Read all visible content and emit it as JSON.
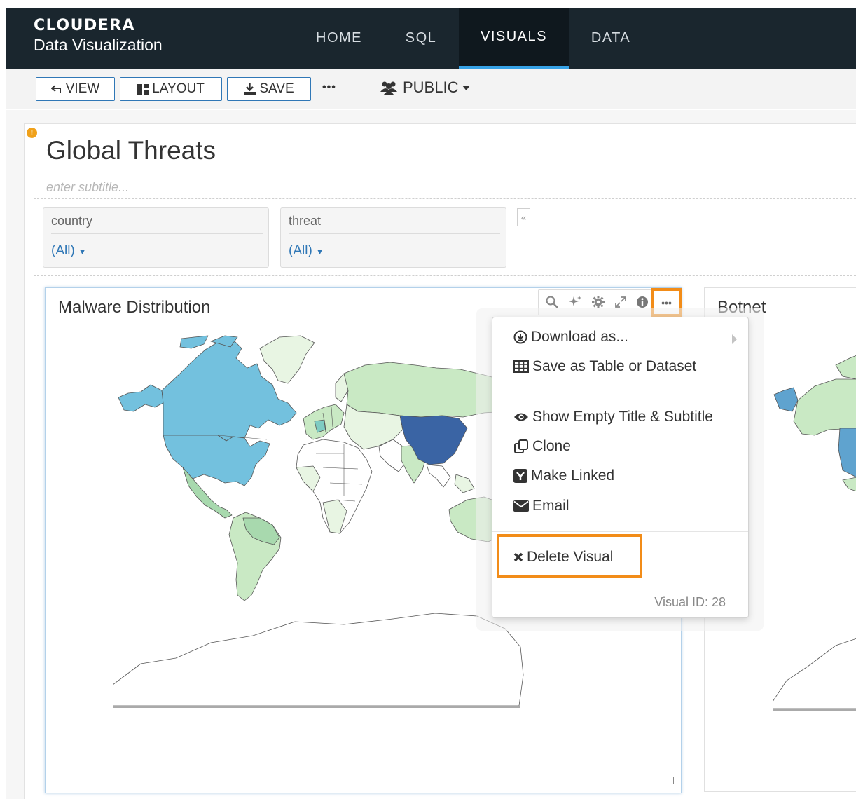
{
  "brand": {
    "name": "CLOUDERA",
    "product": "Data Visualization"
  },
  "nav": {
    "tabs": [
      {
        "label": "HOME"
      },
      {
        "label": "SQL"
      },
      {
        "label": "VISUALS"
      },
      {
        "label": "DATA"
      }
    ],
    "active": "VISUALS"
  },
  "toolbar": {
    "view_label": "VIEW",
    "layout_label": "LAYOUT",
    "save_label": "SAVE",
    "more_label": "•••",
    "visibility_label": "PUBLIC"
  },
  "dashboard": {
    "title": "Global Threats",
    "subtitle_placeholder": "enter subtitle..."
  },
  "filters": [
    {
      "label": "country",
      "value": "(All)"
    },
    {
      "label": "threat",
      "value": "(All)"
    }
  ],
  "filters_collapse_label": "«",
  "visuals": [
    {
      "title": "Malware Distribution"
    },
    {
      "title": "Botnet"
    }
  ],
  "menu": {
    "download": "Download as...",
    "save_table": "Save as Table or Dataset",
    "show_empty": "Show Empty Title & Subtitle",
    "clone": "Clone",
    "make_linked": "Make Linked",
    "email": "Email",
    "delete": "Delete Visual",
    "visual_id": "Visual ID: 28"
  },
  "map": {
    "colors": {
      "darkest": "#3a64a4",
      "dark": "#5fa3cf",
      "medium": "#73c1de",
      "teal": "#7ecbc2",
      "light": "#a8d9ae",
      "lighter": "#c9e9c4",
      "lightest": "#e8f5e3",
      "empty": "#ffffff",
      "border": "#555555"
    },
    "highlighted_countries": [
      "China",
      "United States",
      "Canada",
      "Greenland",
      "Russia",
      "Brazil",
      "Australia",
      "Europe"
    ]
  },
  "icons": {
    "search": "search-icon",
    "ai": "sparkle-icon",
    "settings": "gear-icon",
    "expand": "expand-icon",
    "info": "info-icon",
    "more": "more-icon"
  }
}
